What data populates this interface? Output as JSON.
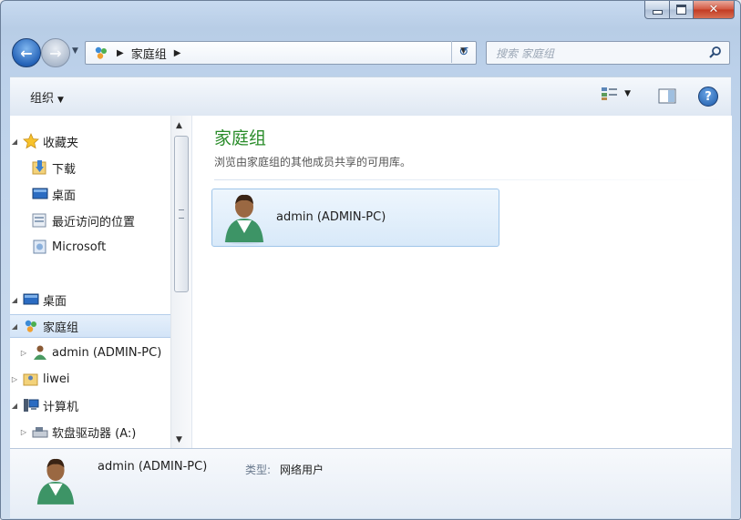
{
  "window": {
    "caption": {
      "close_glyph": "✕"
    }
  },
  "nav": {
    "address": {
      "location": "家庭组"
    },
    "search": {
      "placeholder": "搜索 家庭组"
    }
  },
  "toolbar": {
    "organize_label": "组织",
    "icons": [
      "views-icon",
      "preview-pane-icon",
      "help-icon"
    ]
  },
  "tree": {
    "items": [
      {
        "label": "收藏夹",
        "icon": "star-icon",
        "expanded": true
      },
      {
        "label": "下载",
        "icon": "downloads-folder-icon"
      },
      {
        "label": "桌面",
        "icon": "desktop-icon"
      },
      {
        "label": "最近访问的位置",
        "icon": "recent-places-icon"
      },
      {
        "label": "Microsoft",
        "icon": "cloud-folder-icon"
      },
      {
        "label": "桌面",
        "icon": "desktop-icon",
        "expanded": true
      },
      {
        "label": "家庭组",
        "icon": "homegroup-icon",
        "expanded": true,
        "selected": true
      },
      {
        "label": "admin (ADMIN-PC)",
        "icon": "user-icon"
      },
      {
        "label": "liwei",
        "icon": "user-folder-icon"
      },
      {
        "label": "计算机",
        "icon": "computer-icon",
        "expanded": true
      },
      {
        "label": "软盘驱动器 (A:)",
        "icon": "floppy-drive-icon"
      }
    ]
  },
  "content": {
    "title": "家庭组",
    "subtitle": "浏览由家庭组的其他成员共享的可用库。",
    "tiles": [
      {
        "label": "admin (ADMIN-PC)",
        "icon": "user-avatar-icon"
      }
    ]
  },
  "details": {
    "name": "admin (ADMIN-PC)",
    "type_key": "类型:",
    "type_value": "网络用户"
  },
  "colors": {
    "title_green": "#2a8c2a",
    "selection_blue": "#d3e4f7",
    "close_red": "#c23a22"
  }
}
